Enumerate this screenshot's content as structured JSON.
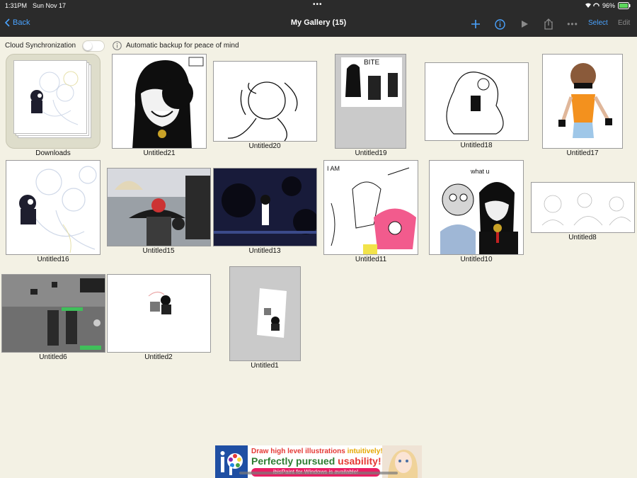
{
  "status": {
    "time": "1:31PM",
    "date": "Sun Nov 17",
    "battery": "96%"
  },
  "nav": {
    "back_label": "Back",
    "title": "My Gallery (15)",
    "select_label": "Select",
    "edit_label": "Edit",
    "accent": "#4aa3ff"
  },
  "sync": {
    "label": "Cloud Synchronization",
    "info_text": "Automatic backup for peace of mind",
    "enabled": false
  },
  "gallery": {
    "folder": {
      "label": "Downloads",
      "icon": "stacked-drawings-icon"
    },
    "items": [
      {
        "label": "Untitled21"
      },
      {
        "label": "Untitled20"
      },
      {
        "label": "Untitled19"
      },
      {
        "label": "Untitled18"
      },
      {
        "label": "Untitled17"
      },
      {
        "label": "Untitled16"
      },
      {
        "label": "Untitled15"
      },
      {
        "label": "Untitled13"
      },
      {
        "label": "Untitled11"
      },
      {
        "label": "Untitled10"
      },
      {
        "label": "Untitled8"
      },
      {
        "label": "Untitled6"
      },
      {
        "label": "Untitled2"
      },
      {
        "label": "Untitled1"
      }
    ]
  },
  "ad": {
    "line1_a": "Draw ",
    "line1_b": "high level illustrations",
    "line1_c": " intuitively!",
    "line2_a": "Perfectly pursued ",
    "line2_b": "usability!",
    "line3": "ibisPaint for Windows is available!"
  }
}
